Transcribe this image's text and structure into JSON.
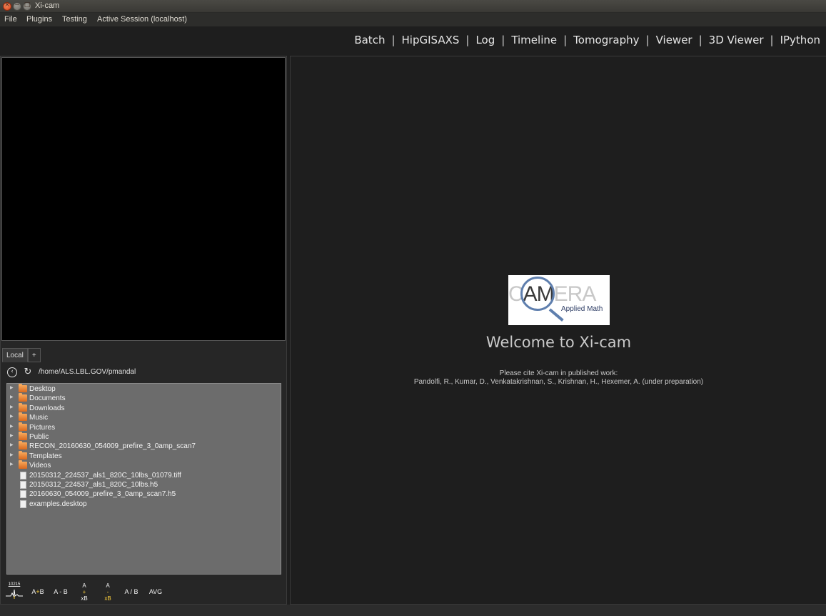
{
  "window": {
    "title": "Xi-cam"
  },
  "menubar": {
    "items": [
      "File",
      "Plugins",
      "Testing",
      "Active Session (localhost)"
    ]
  },
  "plugins_nav": {
    "links": [
      "Batch",
      "HipGISAXS",
      "Log",
      "Timeline",
      "Tomography",
      "Viewer",
      "3D Viewer",
      "IPython"
    ],
    "separator": "|"
  },
  "browser": {
    "tabs": [
      "Local",
      "+"
    ],
    "path": "/home/ALS.LBL.GOV/pmandal",
    "items": [
      {
        "name": "Desktop",
        "type": "folder",
        "icon": "folder-icon"
      },
      {
        "name": "Documents",
        "type": "folder",
        "icon": "folder-icon"
      },
      {
        "name": "Downloads",
        "type": "folder",
        "icon": "folder-icon"
      },
      {
        "name": "Music",
        "type": "folder",
        "icon": "folder-icon"
      },
      {
        "name": "Pictures",
        "type": "folder",
        "icon": "folder-icon"
      },
      {
        "name": "Public",
        "type": "folder",
        "icon": "folder-icon"
      },
      {
        "name": "RECON_20160630_054009_prefire_3_0amp_scan7",
        "type": "folder",
        "icon": "folder-icon"
      },
      {
        "name": "Templates",
        "type": "folder",
        "icon": "folder-icon"
      },
      {
        "name": "Videos",
        "type": "folder",
        "icon": "folder-icon"
      },
      {
        "name": "20150312_224537_als1_820C_10lbs_01079.tiff",
        "type": "file",
        "icon": "file-icon"
      },
      {
        "name": "20150312_224537_als1_820C_10lbs.h5",
        "type": "file",
        "icon": "file-icon"
      },
      {
        "name": "20160630_054009_prefire_3_0amp_scan7.h5",
        "type": "file",
        "icon": "file-icon"
      },
      {
        "name": "examples.desktop",
        "type": "file",
        "icon": "file-icon"
      }
    ]
  },
  "operations": {
    "tile_label": "10215",
    "add": [
      "A",
      "+",
      "B"
    ],
    "subtract": "A - B",
    "add_times_a": "A",
    "add_times_op": "+",
    "add_times_b": "xB",
    "sub_times_a": "A",
    "sub_times_op": "-",
    "sub_times_b": "xB",
    "divide": "A / B",
    "average": "AVG"
  },
  "welcome": {
    "logo_letters": {
      "faded_left": "C",
      "dark": "AM",
      "faded_right": "ERA"
    },
    "logo_subtitle": "Applied Math",
    "heading": "Welcome to Xi-cam",
    "cite_line1": "Please cite Xi-cam in published work:",
    "cite_line2": "Pandolfi, R., Kumar, D., Venkatakrishnan, S., Krishnan, H., Hexemer, A. (under preparation)"
  },
  "colors": {
    "background": "#1e1e1e",
    "file_tree_bg": "#6c6c6c",
    "folder": "#e8853a",
    "logo_accent": "#5f7fae"
  }
}
